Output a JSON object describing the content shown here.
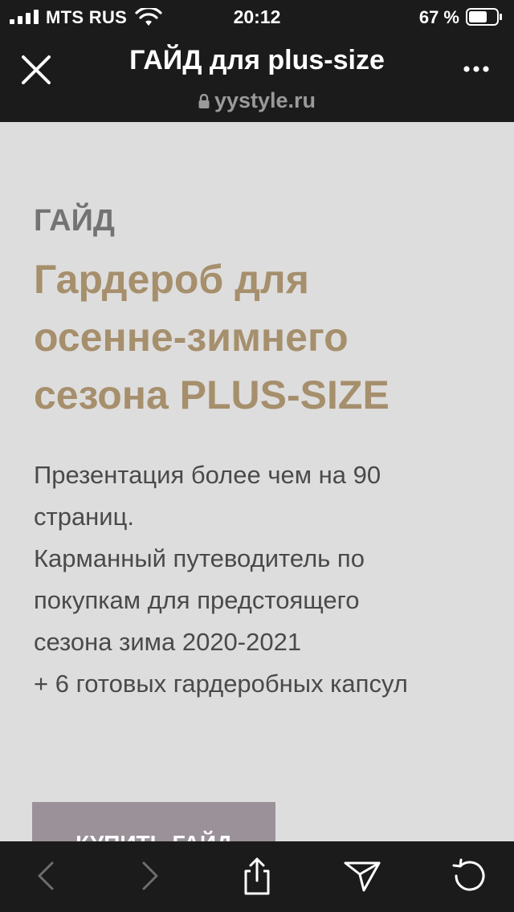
{
  "status_bar": {
    "carrier": "MTS RUS",
    "time": "20:12",
    "battery_percent": "67 %"
  },
  "browser": {
    "title": "ГАЙД для plus-size",
    "url": "yystyle.ru",
    "close_icon": "close-icon",
    "more_icon": "more-icon",
    "lock_icon": "lock-icon"
  },
  "page": {
    "eyebrow": "ГАЙД",
    "headline_lines": [
      "Гардероб для",
      "осенне-зимнего",
      "сезона PLUS-SIZE"
    ],
    "description_lines": [
      "Презентация более чем на 90",
      "страниц.",
      "Карманный путеводитель по",
      "покупкам для предстоящего",
      "сезона зима 2020-2021",
      "+ 6 готовых гардеробных капсул"
    ],
    "cta_label": "КУПИТЬ ГАЙД"
  },
  "toolbar": {
    "back_icon": "back-icon",
    "forward_icon": "forward-icon",
    "share_icon": "share-icon",
    "send_icon": "send-icon",
    "reload_icon": "reload-icon"
  },
  "colors": {
    "bar_bg": "#1b1b1b",
    "page_bg": "#dedddd",
    "accent_gold": "#a68f6c",
    "button_bg": "#9a9199"
  }
}
